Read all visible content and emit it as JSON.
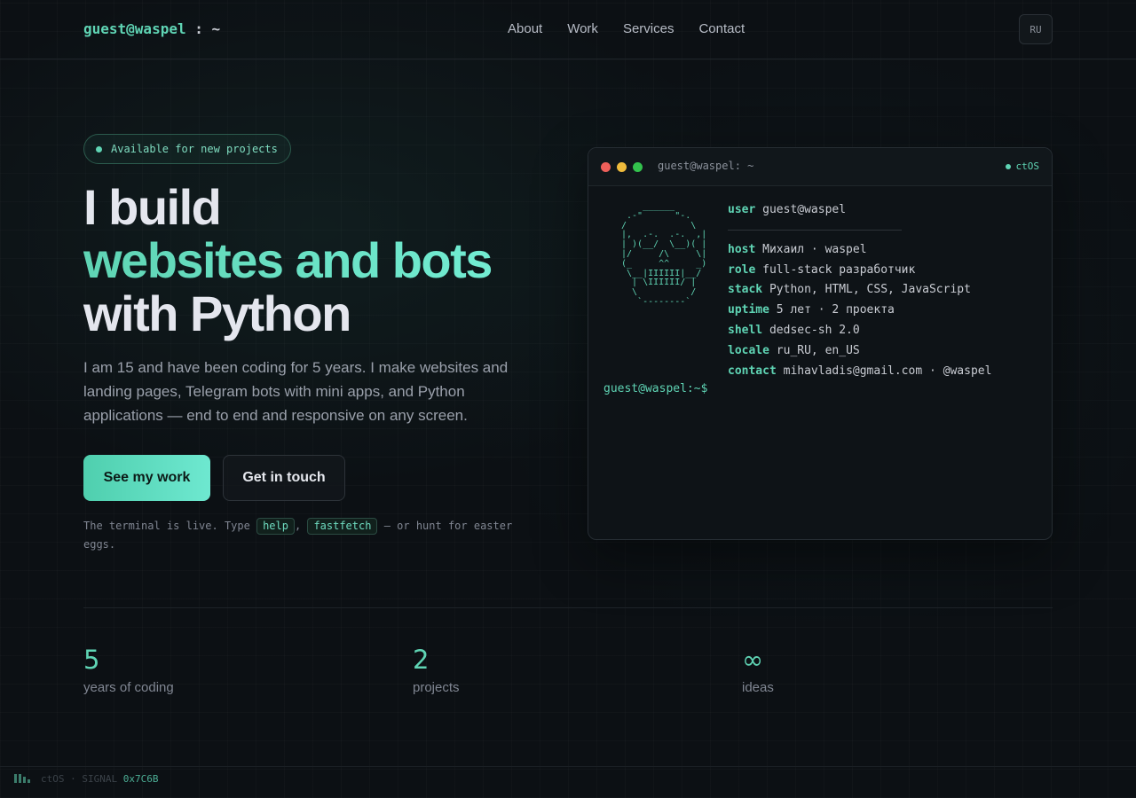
{
  "header": {
    "brand_user": "guest@waspel",
    "brand_sep": " : ~",
    "nav": [
      "About",
      "Work",
      "Services",
      "Contact"
    ],
    "lang": "RU"
  },
  "hero": {
    "badge": "Available for new projects",
    "title_line1": "I build",
    "title_line2": "websites and bots",
    "title_line3": "with Python",
    "lead": "I am 15 and have been coding for 5 years. I make websites and landing pages, Telegram bots with mini apps, and Python applications — end to end and responsive on any screen.",
    "primary_button": "See my work",
    "secondary_button": "Get in touch",
    "hint_prefix": "The terminal is live. Type ",
    "hint_cmd1": "help",
    "hint_comma": ", ",
    "hint_cmd2": "fastfetch",
    "hint_suffix": " — or hunt for easter eggs."
  },
  "terminal": {
    "title": "guest@waspel: ~",
    "os_label": "ctOS",
    "ascii": "    ______\n .-\"      \"-.\n/            \\\n|,  .-.  .-.  ,|\n| )(__/  \\__)( |\n|/     /\\     \\|\n(_     ^^     _)\n \\__|IIIIII|__/\n  | \\IIIIII/ |\n  \\          /\n   `--------`",
    "user_key": "user",
    "user_val": "guest@waspel",
    "rows": [
      {
        "key": "host",
        "val": "Михаил · waspel"
      },
      {
        "key": "role",
        "val": "full-stack разработчик"
      },
      {
        "key": "stack",
        "val": "Python, HTML, CSS, JavaScript"
      },
      {
        "key": "uptime",
        "val": "5 лет · 2 проекта"
      },
      {
        "key": "shell",
        "val": "dedsec-sh 2.0"
      },
      {
        "key": "locale",
        "val": "ru_RU, en_US"
      },
      {
        "key": "contact",
        "val": "mihavladis@gmail.com · @waspel"
      }
    ],
    "prompt": "guest@waspel:~$"
  },
  "stats": [
    {
      "num": "5",
      "label": "years of coding"
    },
    {
      "num": "2",
      "label": "projects"
    },
    {
      "num": "∞",
      "label": "ideas"
    }
  ],
  "footer": {
    "os": "ctOS",
    "dot": " · ",
    "signal": "SIGNAL ",
    "hex": "0x7C6B"
  },
  "icons": {
    "status_dot": "status-dot-icon",
    "signal_bars": "signal-bars-icon"
  },
  "colors": {
    "accent": "#5fd4b4",
    "background": "#0c1014"
  }
}
